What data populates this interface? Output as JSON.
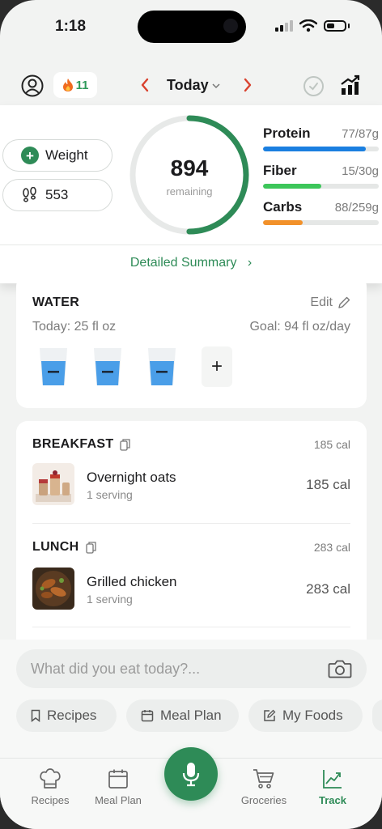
{
  "status": {
    "time": "1:18"
  },
  "header": {
    "streak_count": "11",
    "date_label": "Today"
  },
  "summary": {
    "weight_label": "Weight",
    "steps_value": "553",
    "remaining_value": "894",
    "remaining_label": "remaining",
    "ring_progress": 0.5,
    "macros": [
      {
        "name": "Protein",
        "amount": "77/87g",
        "progress": 0.89,
        "color": "#1a7fe0"
      },
      {
        "name": "Fiber",
        "amount": "15/30g",
        "progress": 0.5,
        "color": "#3cc65a"
      },
      {
        "name": "Carbs",
        "amount": "88/259g",
        "progress": 0.34,
        "color": "#f2912a"
      }
    ],
    "detail_link": "Detailed Summary"
  },
  "water": {
    "title": "WATER",
    "edit_label": "Edit",
    "today": "Today: 25 fl oz",
    "goal": "Goal: 94 fl oz/day",
    "cups_filled": 3,
    "accent": "#4a9ee8"
  },
  "meals": [
    {
      "title": "BREAKFAST",
      "calories": "185 cal",
      "food": "Overnight oats",
      "serving": "1 serving",
      "food_calories": "185 cal"
    },
    {
      "title": "LUNCH",
      "calories": "283 cal",
      "food": "Grilled chicken",
      "serving": "1 serving",
      "food_calories": "283 cal"
    }
  ],
  "input": {
    "placeholder": "What did you eat today?..."
  },
  "chips": [
    "Recipes",
    "Meal Plan",
    "My Foods"
  ],
  "tabs": [
    "Recipes",
    "Meal Plan",
    "Groceries",
    "Track"
  ],
  "colors": {
    "brand": "#2e8b57",
    "nav_arrow": "#d9412e"
  }
}
